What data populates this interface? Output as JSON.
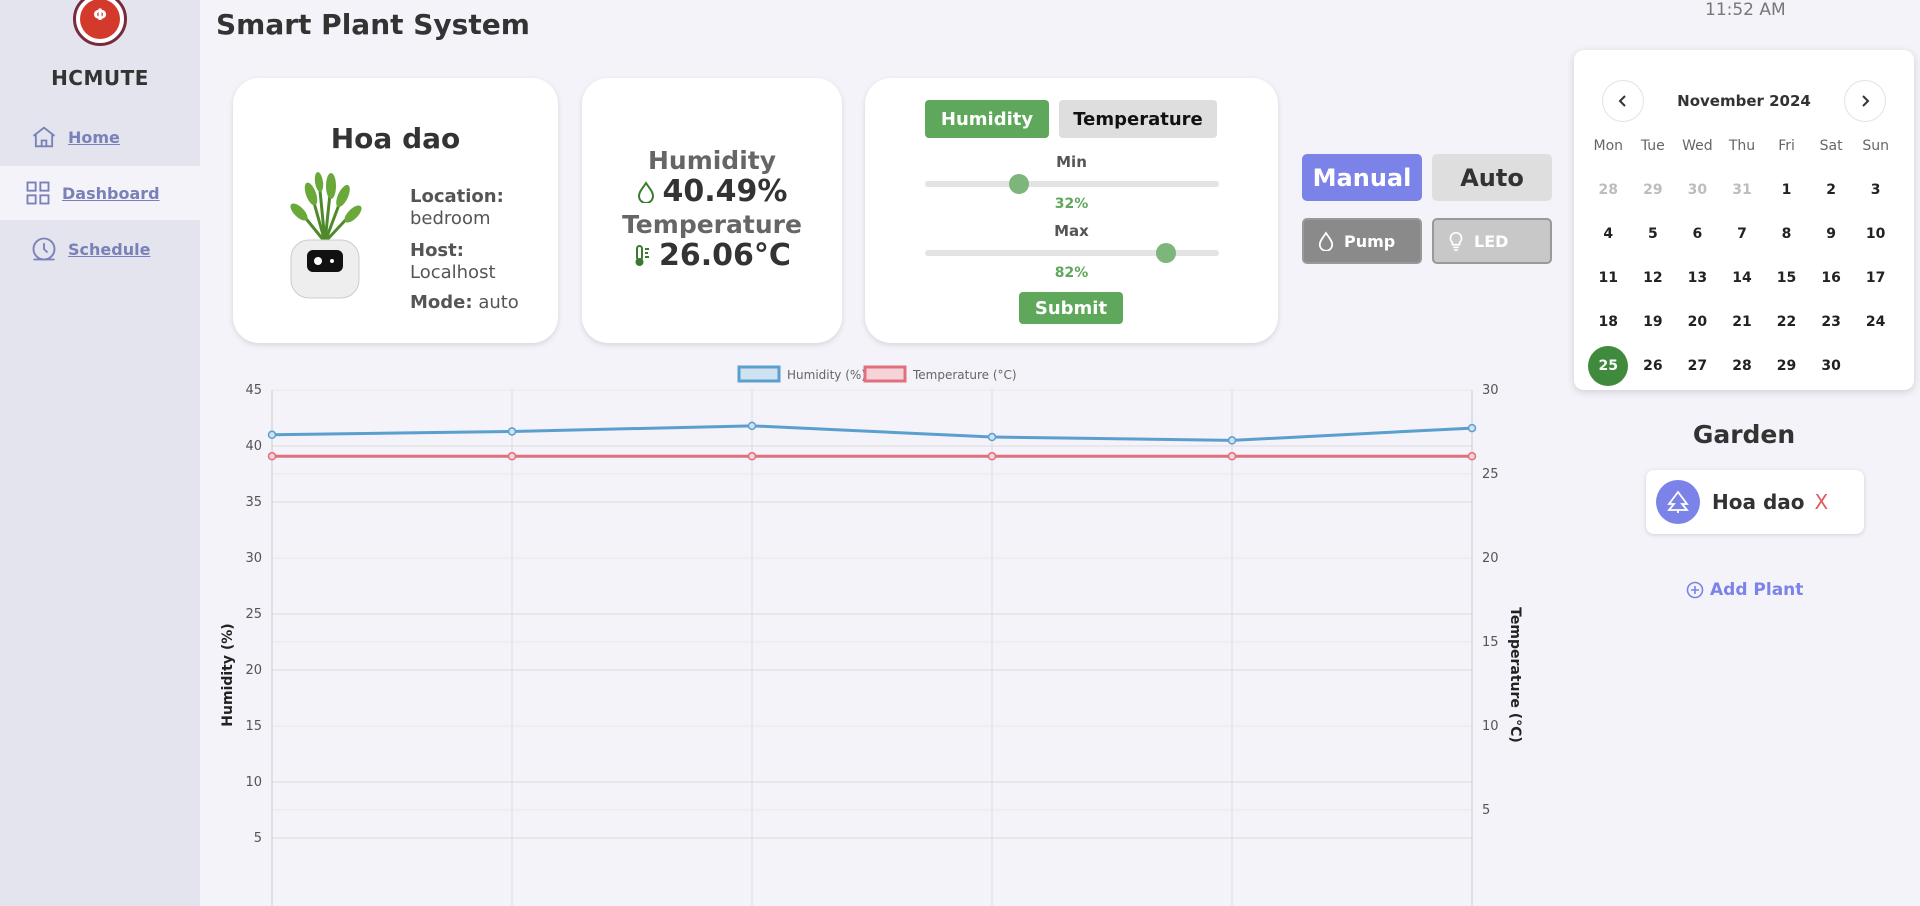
{
  "sidebar": {
    "brand": "HCMUTE",
    "items": [
      {
        "label": "Home",
        "icon": "home-icon"
      },
      {
        "label": "Dashboard",
        "icon": "grid-icon",
        "active": true
      },
      {
        "label": "Schedule",
        "icon": "clock-icon"
      }
    ]
  },
  "header": {
    "title": "Smart Plant System",
    "time": "11:52 AM"
  },
  "plant": {
    "name": "Hoa dao",
    "location_label": "Location:",
    "location": "bedroom",
    "host_label": "Host:",
    "host": "Localhost",
    "mode_label": "Mode:",
    "mode": "auto"
  },
  "sensors": {
    "humidity_label": "Humidity",
    "humidity": "40.49%",
    "temperature_label": "Temperature",
    "temperature": "26.06°C"
  },
  "control": {
    "tabs": [
      "Humidity",
      "Temperature"
    ],
    "active_tab": "Humidity",
    "min_label": "Min",
    "min_value": "32%",
    "min_level": 0.32,
    "max_label": "Max",
    "max_value": "82%",
    "max_level": 0.82,
    "submit_label": "Submit"
  },
  "modes": {
    "manual": "Manual",
    "auto": "Auto",
    "selected": "Manual"
  },
  "devices": {
    "pump": "Pump",
    "led": "LED"
  },
  "calendar": {
    "title": "November 2024",
    "weekdays": [
      "Mon",
      "Tue",
      "Wed",
      "Thu",
      "Fri",
      "Sat",
      "Sun"
    ],
    "days": [
      "28",
      "29",
      "30",
      "31",
      "1",
      "2",
      "3",
      "4",
      "5",
      "6",
      "7",
      "8",
      "9",
      "10",
      "11",
      "12",
      "13",
      "14",
      "15",
      "16",
      "17",
      "18",
      "19",
      "20",
      "21",
      "22",
      "23",
      "24",
      "25",
      "26",
      "27",
      "28",
      "29",
      "30"
    ],
    "muted_count": 4,
    "selected": "25"
  },
  "garden": {
    "title": "Garden",
    "items": [
      {
        "name": "Hoa dao",
        "remove": "X"
      }
    ],
    "add_label": "Add Plant"
  },
  "colors": {
    "accent": "#7b83e8",
    "green": "#5fa85b",
    "humidity_line": "#5b9fcf",
    "temperature_line": "#e0707d"
  },
  "chart_data": {
    "type": "line",
    "legend": [
      "Humidity (%)",
      "Temperature (°C)"
    ],
    "ylabel_left": "Humidity (%)",
    "ylabel_right": "Temperature (°C)",
    "y_left_ticks": [
      "45",
      "40",
      "35",
      "30",
      "25",
      "20",
      "15",
      "10",
      "5"
    ],
    "y_right_ticks": [
      "30",
      "25",
      "20",
      "15",
      "10",
      "5"
    ],
    "ylim_left": [
      0,
      45
    ],
    "ylim_right": [
      0,
      30
    ],
    "series": [
      {
        "name": "Humidity (%)",
        "values": [
          41.0,
          41.3,
          41.8,
          40.8,
          40.5,
          41.6
        ]
      },
      {
        "name": "Temperature (°C)",
        "values": [
          26.06,
          26.06,
          26.06,
          26.06,
          26.06,
          26.06
        ]
      }
    ],
    "grid": true
  }
}
